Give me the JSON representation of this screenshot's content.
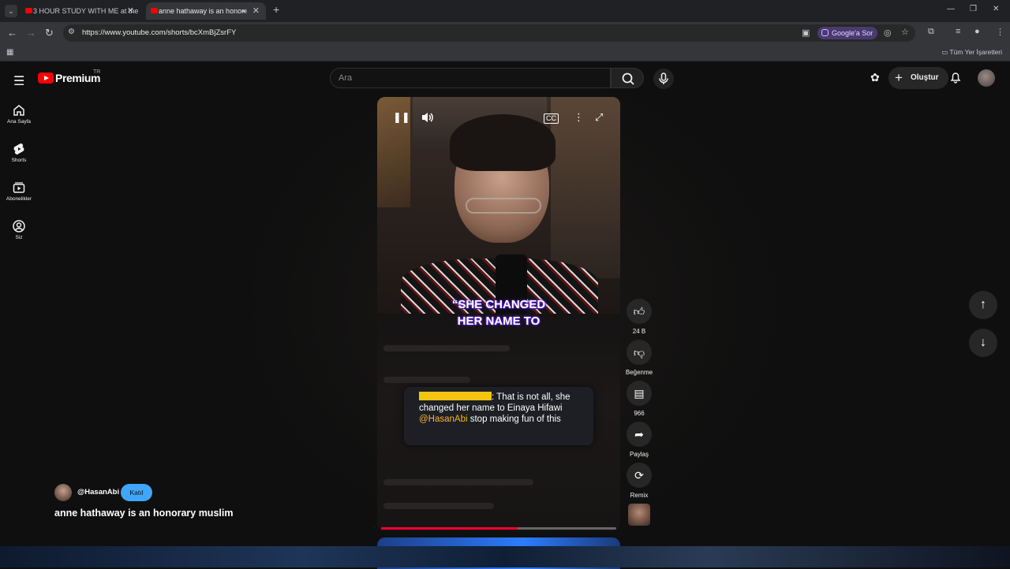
{
  "browser": {
    "tabs": [
      {
        "title": "3 HOUR STUDY WITH ME at the",
        "active": false
      },
      {
        "title": "anne hathaway is an honor",
        "active": true
      }
    ],
    "url": "https://www.youtube.com/shorts/bcXmBjZsrFY",
    "google_ask": "Google'a Sor",
    "all_bookmarks": "Tüm Yer İşaretleri"
  },
  "youtube": {
    "logo": "Premium",
    "country": "TR",
    "search_placeholder": "Ara",
    "create_label": "Oluştur",
    "guide": [
      {
        "label": "Ana Sayfa",
        "icon": "home-icon"
      },
      {
        "label": "Shorts",
        "icon": "shorts-icon"
      },
      {
        "label": "Abonelikler",
        "icon": "subscriptions-icon"
      },
      {
        "label": "Siz",
        "icon": "you-icon"
      }
    ]
  },
  "short": {
    "caption_line1": "“SHE CHANGED",
    "caption_line2": "HER NAME TO",
    "comment_text": ": That is not all, she changed her name to Einaya Hifawi",
    "comment_mention": "@HasanAbi",
    "comment_tail": " stop making fun of this",
    "progress": 0.58,
    "channel": "@HasanAbi",
    "join_label": "Katıl",
    "title": "anne hathaway is an honorary muslim"
  },
  "actions": {
    "likes": "24 B",
    "dislike_label": "Beğenme",
    "comments": "966",
    "share_label": "Paylaş",
    "remix_label": "Remix"
  }
}
